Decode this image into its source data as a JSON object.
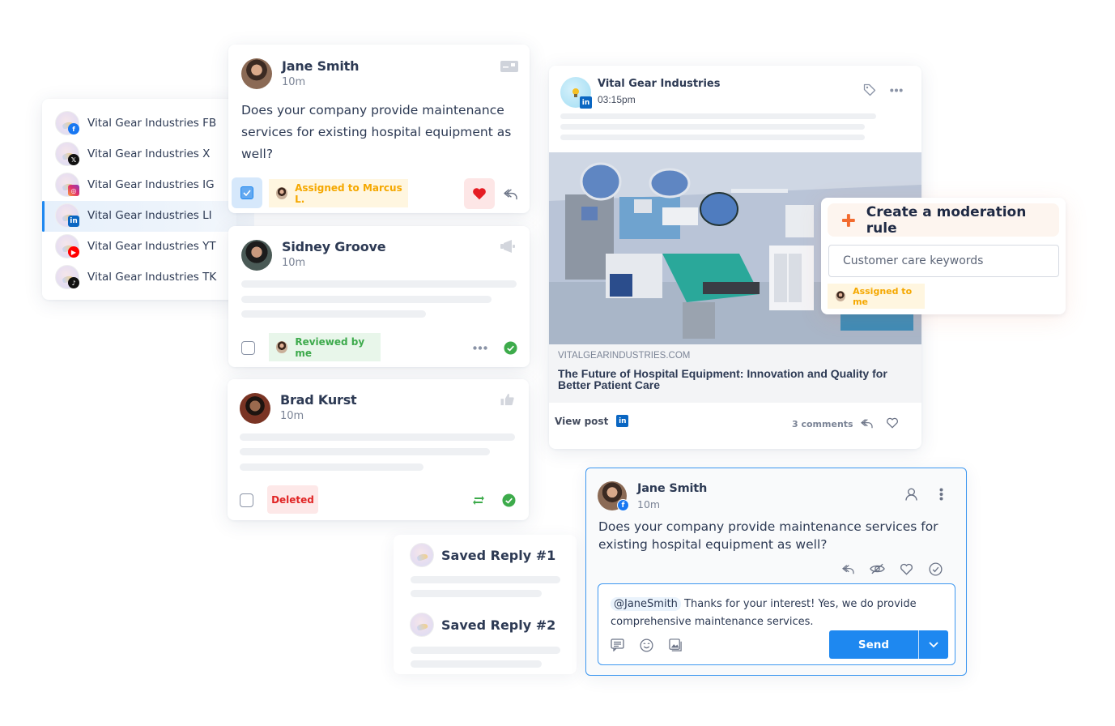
{
  "accounts": {
    "items": [
      {
        "label": "Vital Gear Industries FB",
        "network": "facebook",
        "badge_color": "#1877f2",
        "selected": false
      },
      {
        "label": "Vital Gear Industries X",
        "network": "x",
        "badge_color": "#111111",
        "selected": false
      },
      {
        "label": "Vital Gear Industries IG",
        "network": "instagram",
        "badge_color": "#e1306c",
        "selected": false
      },
      {
        "label": "Vital Gear Industries LI",
        "network": "linkedin",
        "badge_color": "#0a66c2",
        "selected": true
      },
      {
        "label": "Vital Gear Industries YT",
        "network": "youtube",
        "badge_color": "#ff0000",
        "selected": false
      },
      {
        "label": "Vital Gear Industries TK",
        "network": "tiktok",
        "badge_color": "#111111",
        "selected": false
      }
    ],
    "selected_accent": "#1e88f0"
  },
  "messages": [
    {
      "author": "Jane Smith",
      "time": "10m",
      "text": "Does your company provide maintenance services for existing hospital equipment as well?",
      "type_icon": "direct-message-icon",
      "checked": true,
      "tag": {
        "label": "Assigned to Marcus L.",
        "color": "#f5a800",
        "bg": "#fff6e0"
      },
      "liked": true
    },
    {
      "author": "Sidney Groove",
      "time": "10m",
      "type_icon": "megaphone-icon",
      "checked": false,
      "tag": {
        "label": "Reviewed by me",
        "color": "#3daa4c",
        "bg": "#e8f6ea"
      },
      "completed": true
    },
    {
      "author": "Brad Kurst",
      "time": "10m",
      "type_icon": "thumbs-up-icon",
      "checked": false,
      "tag": {
        "label": "Deleted",
        "color": "#e02424",
        "bg": "#fde8e8"
      },
      "completed": true
    }
  ],
  "post": {
    "author": "Vital Gear Industries",
    "time": "03:15pm",
    "network": "linkedin",
    "link_domain": "VITALGEARINDUSTRIES.COM",
    "link_title": "The Future of Hospital Equipment: Innovation and Quality for Better Patient Care",
    "view_post_label": "View post",
    "comments_label": "3 comments"
  },
  "moderation": {
    "title": "Create a moderation rule",
    "input_value": "Customer care keywords",
    "tag_label": "Assigned to me",
    "plus_color": "#f26b2f"
  },
  "saved_replies": [
    {
      "title": "Saved Reply #1"
    },
    {
      "title": "Saved Reply #2"
    }
  ],
  "reply": {
    "author": "Jane Smith",
    "time": "10m",
    "network": "facebook",
    "text": "Does your company provide maintenance services for existing hospital equipment as well?",
    "mention": "@JaneSmith",
    "draft": "Thanks for your interest! Yes, we do provide comprehensive maintenance services.",
    "send_label": "Send",
    "accent": "#1e88f0"
  }
}
